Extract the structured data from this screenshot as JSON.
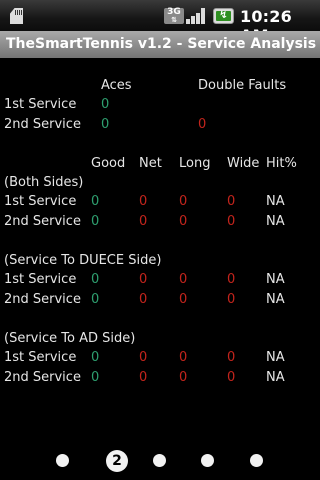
{
  "status_bar": {
    "network_label": "3G",
    "time": "10:26 AM"
  },
  "title_bar": {
    "title": "TheSmartTennis v1.2 - Service Analysis"
  },
  "summary": {
    "headers": [
      "Aces",
      "Double Faults"
    ],
    "rows": [
      {
        "label": "1st Service",
        "aces": "0",
        "double_faults": ""
      },
      {
        "label": "2nd Service",
        "aces": "0",
        "double_faults": "0"
      }
    ]
  },
  "table_headers": [
    "Good",
    "Net",
    "Long",
    "Wide",
    "Hit%"
  ],
  "sections": [
    {
      "title": "(Both Sides)",
      "rows": [
        {
          "label": "1st Service",
          "good": "0",
          "net": "0",
          "long": "0",
          "wide": "0",
          "hit": "NA"
        },
        {
          "label": "2nd Service",
          "good": "0",
          "net": "0",
          "long": "0",
          "wide": "0",
          "hit": "NA"
        }
      ]
    },
    {
      "title": "(Service To DUECE Side)",
      "rows": [
        {
          "label": "1st Service",
          "good": "0",
          "net": "0",
          "long": "0",
          "wide": "0",
          "hit": "NA"
        },
        {
          "label": "2nd Service",
          "good": "0",
          "net": "0",
          "long": "0",
          "wide": "0",
          "hit": "NA"
        }
      ]
    },
    {
      "title": "(Service To AD Side)",
      "rows": [
        {
          "label": "1st Service",
          "good": "0",
          "net": "0",
          "long": "0",
          "wide": "0",
          "hit": "NA"
        },
        {
          "label": "2nd Service",
          "good": "0",
          "net": "0",
          "long": "0",
          "wide": "0",
          "hit": "NA"
        }
      ]
    }
  ],
  "pager": {
    "current_page": "2",
    "total_pages": 5
  },
  "colors": {
    "good_value": "#2e9f6f",
    "fault_value": "#c3241c",
    "title_bar": "#8e8e8e"
  }
}
